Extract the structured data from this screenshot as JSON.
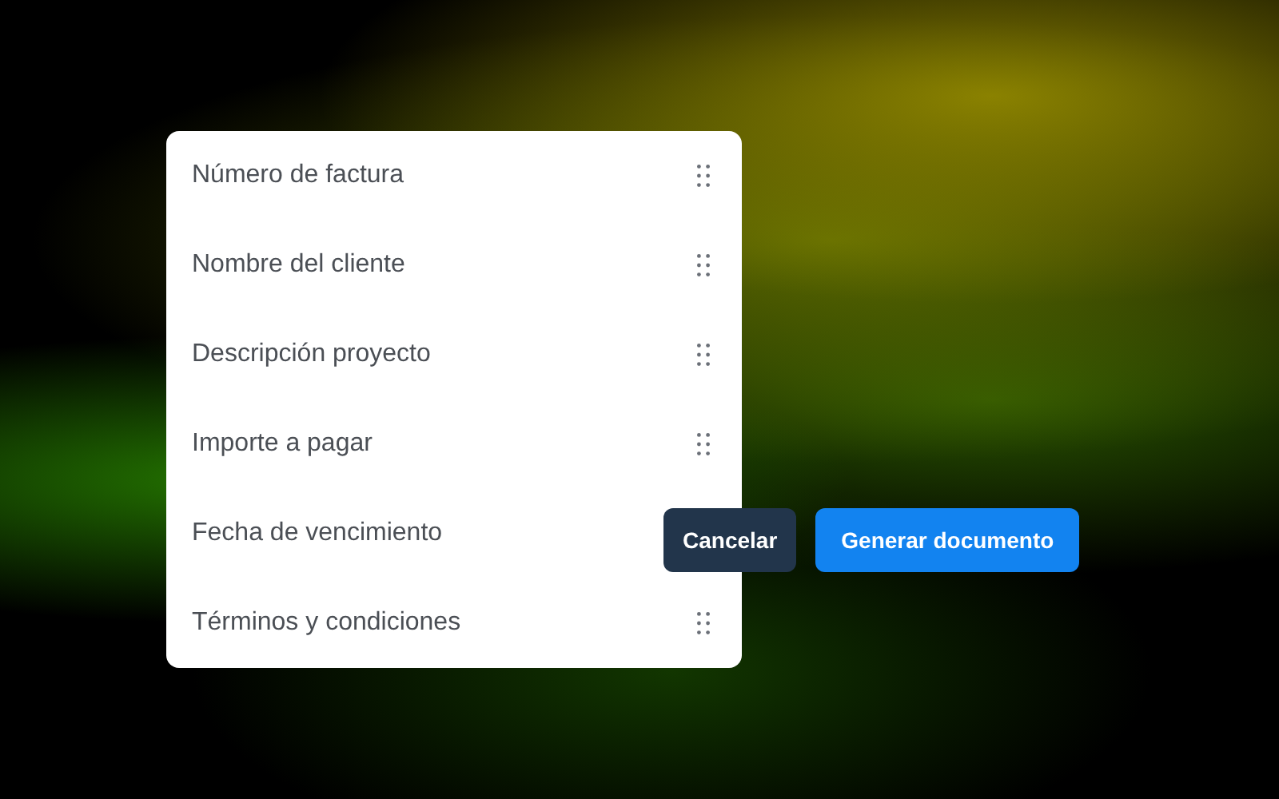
{
  "fields": [
    {
      "label": "Número de factura"
    },
    {
      "label": "Nombre del cliente"
    },
    {
      "label": "Descripción proyecto"
    },
    {
      "label": "Importe a pagar"
    },
    {
      "label": "Fecha de vencimiento"
    },
    {
      "label": "Términos y condiciones"
    }
  ],
  "buttons": [
    {
      "label": "Cancelar",
      "kind": "secondary"
    },
    {
      "label": "Generar documento",
      "kind": "primary"
    }
  ]
}
